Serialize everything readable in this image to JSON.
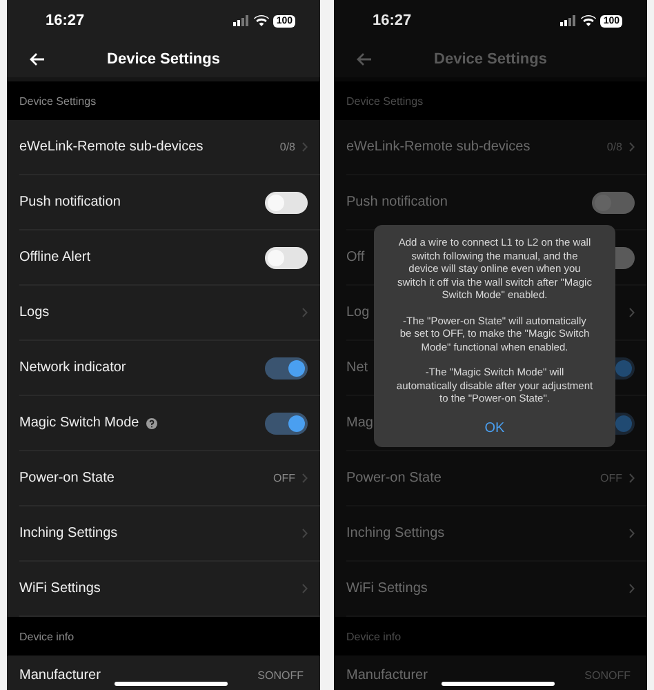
{
  "screens": [
    {
      "status": {
        "time": "16:27",
        "battery": "100"
      },
      "title": "Device Settings",
      "rows": [
        {
          "kind": "header",
          "label": "Device Settings"
        },
        {
          "kind": "value",
          "label": "eWeLink-Remote sub-devices",
          "value": "0/8"
        },
        {
          "kind": "toggle",
          "label": "Push notification",
          "on": false
        },
        {
          "kind": "toggle",
          "label": "Offline Alert",
          "on": false
        },
        {
          "kind": "link",
          "label": "Logs"
        },
        {
          "kind": "toggle",
          "label": "Network indicator",
          "on": true
        },
        {
          "kind": "toggle",
          "label": "Magic Switch Mode",
          "on": true,
          "help": true
        },
        {
          "kind": "value",
          "label": "Power-on State",
          "value": "OFF"
        },
        {
          "kind": "link",
          "label": "Inching Settings"
        },
        {
          "kind": "link",
          "label": "WiFi Settings"
        },
        {
          "kind": "header",
          "label": "Device info"
        },
        {
          "kind": "info",
          "label": "Manufacturer",
          "value": "SONOFF"
        }
      ]
    },
    {
      "status": {
        "time": "16:27",
        "battery": "100"
      },
      "title": "Device Settings",
      "rows": [
        {
          "kind": "header",
          "label": "Device Settings"
        },
        {
          "kind": "value",
          "label": "eWeLink-Remote sub-devices",
          "value": "0/8"
        },
        {
          "kind": "toggle",
          "label": "Push notification",
          "on": false
        },
        {
          "kind": "toggle",
          "label": "Off",
          "on": false
        },
        {
          "kind": "link",
          "label": "Log"
        },
        {
          "kind": "toggle",
          "label": "Net",
          "on": true
        },
        {
          "kind": "toggle",
          "label": "Mag",
          "on": true
        },
        {
          "kind": "value",
          "label": "Power-on State",
          "value": "OFF"
        },
        {
          "kind": "link",
          "label": "Inching Settings"
        },
        {
          "kind": "link",
          "label": "WiFi Settings"
        },
        {
          "kind": "header",
          "label": "Device info"
        },
        {
          "kind": "info",
          "label": "Manufacturer",
          "value": "SONOFF"
        }
      ],
      "dialog": {
        "paragraphs": [
          "Add a wire to connect L1 to L2 on the wall switch following the manual, and the device will stay online even when you switch it off via the wall switch after \"Magic Switch Mode\" enabled.",
          "-The \"Power-on State\" will automatically be set to OFF, to make the \"Magic Switch Mode\" functional when enabled.",
          "-The \"Magic Switch Mode\" will automatically disable after your adjustment to the \"Power-on State\"."
        ],
        "button": "OK"
      }
    }
  ]
}
